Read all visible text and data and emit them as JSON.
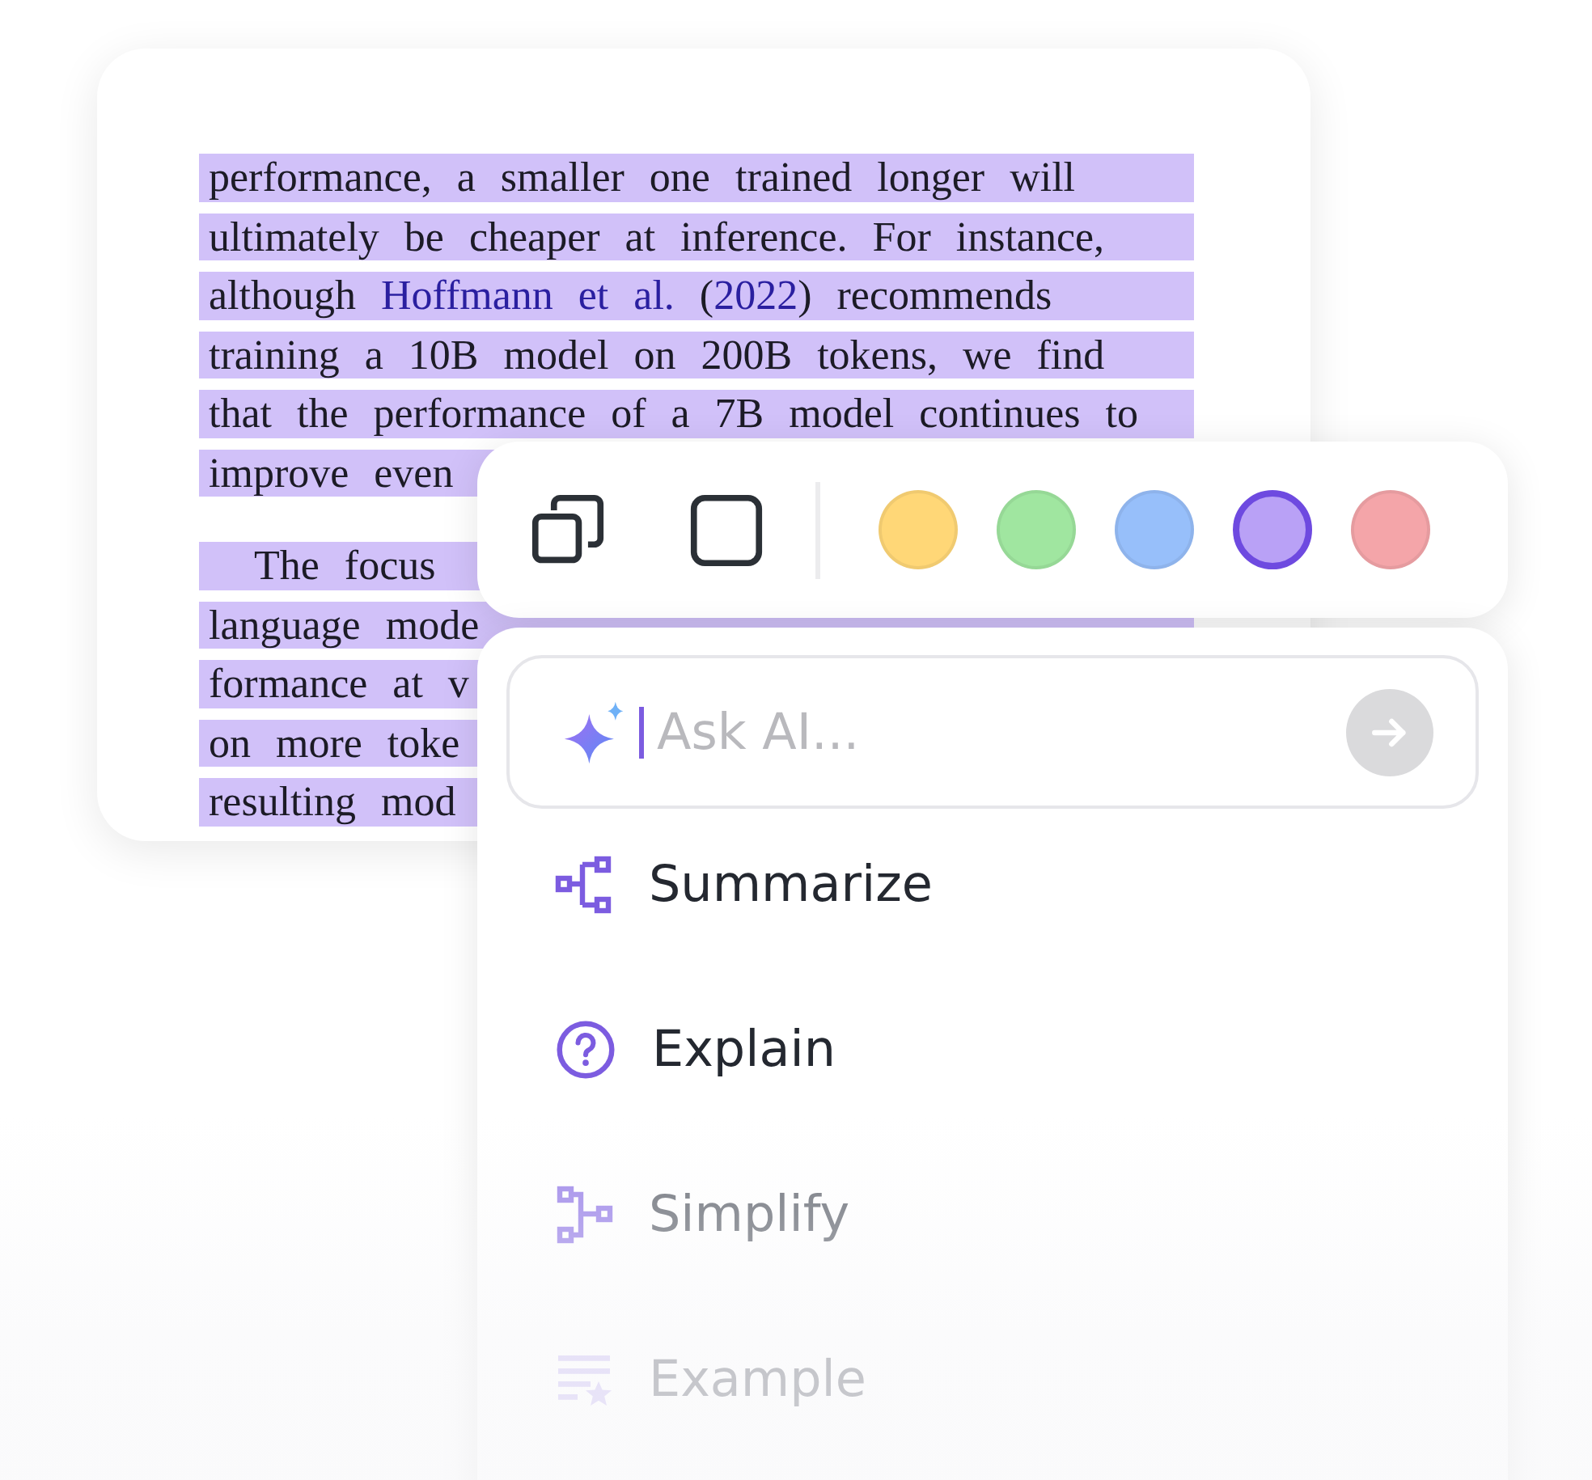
{
  "document": {
    "paragraphs": [
      {
        "indent": false,
        "lines": [
          {
            "segments": [
              {
                "kind": "plain",
                "text": "performance, a smaller one trained longer will"
              }
            ]
          },
          {
            "segments": [
              {
                "kind": "plain",
                "text": "ultimately be cheaper at inference. For instance,"
              }
            ]
          },
          {
            "segments": [
              {
                "kind": "plain",
                "text": "although "
              },
              {
                "kind": "link",
                "text": "Hoffmann et al."
              },
              {
                "kind": "plain",
                "text": " ("
              },
              {
                "kind": "link",
                "text": "2022"
              },
              {
                "kind": "plain",
                "text": ") recommends"
              }
            ]
          },
          {
            "segments": [
              {
                "kind": "plain",
                "text": "training a 10B model on 200B tokens, we find"
              }
            ]
          },
          {
            "segments": [
              {
                "kind": "plain",
                "text": "that the performance of a 7B model continues to"
              }
            ]
          },
          {
            "segments": [
              {
                "kind": "plain",
                "text": "improve even"
              }
            ]
          }
        ]
      },
      {
        "indent": true,
        "lines": [
          {
            "segments": [
              {
                "kind": "plain",
                "text": "The focus"
              }
            ]
          },
          {
            "segments": [
              {
                "kind": "plain",
                "text": "language mode"
              }
            ]
          },
          {
            "segments": [
              {
                "kind": "plain",
                "text": "formance at v"
              }
            ]
          },
          {
            "segments": [
              {
                "kind": "plain",
                "text": "on more toke"
              }
            ]
          },
          {
            "segments": [
              {
                "kind": "plain",
                "text": "resulting mod"
              }
            ]
          }
        ]
      }
    ]
  },
  "toolbar": {
    "colors": [
      {
        "color": "#ffd777",
        "selected": false
      },
      {
        "color": "#a0e6a0",
        "selected": false
      },
      {
        "color": "#97bffa",
        "selected": false
      },
      {
        "color": "#b9a1f6",
        "selected": true
      },
      {
        "color": "#f4a5a9",
        "selected": false
      }
    ]
  },
  "ai_panel": {
    "input": {
      "placeholder": "Ask AI..."
    },
    "actions": [
      {
        "label": "Summarize"
      },
      {
        "label": "Explain"
      },
      {
        "label": "Simplify"
      },
      {
        "label": "Example"
      }
    ]
  }
}
